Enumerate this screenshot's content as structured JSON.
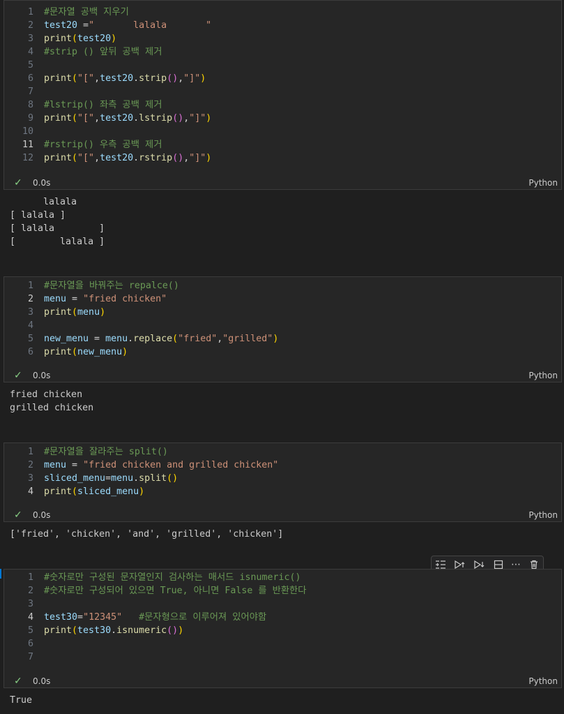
{
  "cells": [
    {
      "lines": [
        [
          {
            "t": "#문자열 공백 지우기",
            "c": "cm"
          }
        ],
        [
          {
            "t": "test20",
            "c": "v"
          },
          {
            "t": " =",
            "c": "p"
          },
          {
            "t": "\"       lalala       \"",
            "c": "s"
          }
        ],
        [
          {
            "t": "print",
            "c": "f"
          },
          {
            "t": "(",
            "c": "b1"
          },
          {
            "t": "test20",
            "c": "v"
          },
          {
            "t": ")",
            "c": "b1"
          }
        ],
        [
          {
            "t": "#strip () 앞뒤 공백 제거",
            "c": "cm"
          }
        ],
        [],
        [
          {
            "t": "print",
            "c": "f"
          },
          {
            "t": "(",
            "c": "b1"
          },
          {
            "t": "\"[\"",
            "c": "s"
          },
          {
            "t": ",",
            "c": "p"
          },
          {
            "t": "test20",
            "c": "v"
          },
          {
            "t": ".",
            "c": "p"
          },
          {
            "t": "strip",
            "c": "f"
          },
          {
            "t": "()",
            "c": "b2"
          },
          {
            "t": ",",
            "c": "p"
          },
          {
            "t": "\"]\"",
            "c": "s"
          },
          {
            "t": ")",
            "c": "b1"
          }
        ],
        [],
        [
          {
            "t": "#lstrip() 좌측 공백 제거",
            "c": "cm"
          }
        ],
        [
          {
            "t": "print",
            "c": "f"
          },
          {
            "t": "(",
            "c": "b1"
          },
          {
            "t": "\"[\"",
            "c": "s"
          },
          {
            "t": ",",
            "c": "p"
          },
          {
            "t": "test20",
            "c": "v"
          },
          {
            "t": ".",
            "c": "p"
          },
          {
            "t": "lstrip",
            "c": "f"
          },
          {
            "t": "()",
            "c": "b2"
          },
          {
            "t": ",",
            "c": "p"
          },
          {
            "t": "\"]\"",
            "c": "s"
          },
          {
            "t": ")",
            "c": "b1"
          }
        ],
        [],
        [
          {
            "t": "#rstrip() 우측 공백 제거",
            "c": "cm"
          }
        ],
        [
          {
            "t": "print",
            "c": "f"
          },
          {
            "t": "(",
            "c": "b1"
          },
          {
            "t": "\"[\"",
            "c": "s"
          },
          {
            "t": ",",
            "c": "p"
          },
          {
            "t": "test20",
            "c": "v"
          },
          {
            "t": ".",
            "c": "p"
          },
          {
            "t": "rstrip",
            "c": "f"
          },
          {
            "t": "()",
            "c": "b2"
          },
          {
            "t": ",",
            "c": "p"
          },
          {
            "t": "\"]\"",
            "c": "s"
          },
          {
            "t": ")",
            "c": "b1"
          }
        ]
      ],
      "active_line": 11,
      "time": "0.0s",
      "lang": "Python",
      "output": [
        "      lalala",
        "[ lalala ]",
        "[ lalala        ]",
        "[        lalala ]"
      ]
    },
    {
      "lines": [
        [
          {
            "t": "#문자열을 바꿔주는 repalce()",
            "c": "cm"
          }
        ],
        [
          {
            "t": "menu",
            "c": "v"
          },
          {
            "t": " = ",
            "c": "p"
          },
          {
            "t": "\"fried chicken\"",
            "c": "s"
          }
        ],
        [
          {
            "t": "print",
            "c": "f"
          },
          {
            "t": "(",
            "c": "b1"
          },
          {
            "t": "menu",
            "c": "v"
          },
          {
            "t": ")",
            "c": "b1"
          }
        ],
        [],
        [
          {
            "t": "new_menu",
            "c": "v"
          },
          {
            "t": " = ",
            "c": "p"
          },
          {
            "t": "menu",
            "c": "v"
          },
          {
            "t": ".",
            "c": "p"
          },
          {
            "t": "replace",
            "c": "f"
          },
          {
            "t": "(",
            "c": "b1"
          },
          {
            "t": "\"fried\"",
            "c": "s"
          },
          {
            "t": ",",
            "c": "p"
          },
          {
            "t": "\"grilled\"",
            "c": "s"
          },
          {
            "t": ")",
            "c": "b1"
          }
        ],
        [
          {
            "t": "print",
            "c": "f"
          },
          {
            "t": "(",
            "c": "b1"
          },
          {
            "t": "new_menu",
            "c": "v"
          },
          {
            "t": ")",
            "c": "b1"
          }
        ]
      ],
      "active_line": 2,
      "time": "0.0s",
      "lang": "Python",
      "output": [
        "fried chicken",
        "grilled chicken"
      ]
    },
    {
      "lines": [
        [
          {
            "t": "#문자열을 잘라주는 split()",
            "c": "cm"
          }
        ],
        [
          {
            "t": "menu",
            "c": "v"
          },
          {
            "t": " = ",
            "c": "p"
          },
          {
            "t": "\"fried chicken and grilled chicken\"",
            "c": "s"
          }
        ],
        [
          {
            "t": "sliced_menu",
            "c": "v"
          },
          {
            "t": "=",
            "c": "p"
          },
          {
            "t": "menu",
            "c": "v"
          },
          {
            "t": ".",
            "c": "p"
          },
          {
            "t": "split",
            "c": "f"
          },
          {
            "t": "()",
            "c": "b1"
          }
        ],
        [
          {
            "t": "print",
            "c": "f"
          },
          {
            "t": "(",
            "c": "b1"
          },
          {
            "t": "sliced_menu",
            "c": "v"
          },
          {
            "t": ")",
            "c": "b1"
          }
        ]
      ],
      "active_line": 4,
      "time": "0.0s",
      "lang": "Python",
      "output": [
        "['fried', 'chicken', 'and', 'grilled', 'chicken']"
      ]
    },
    {
      "lines": [
        [
          {
            "t": "#숫자로만 구성된 문자열인지 검사하는 매서드 isnumeric()",
            "c": "cm"
          }
        ],
        [
          {
            "t": "#숫자로만 구성되어 있으면 True, 아니면 False 를 반환한다",
            "c": "cm"
          }
        ],
        [],
        [
          {
            "t": "test30",
            "c": "v"
          },
          {
            "t": "=",
            "c": "p"
          },
          {
            "t": "\"12345\"",
            "c": "s"
          },
          {
            "t": "   ",
            "c": "p"
          },
          {
            "t": "#문자형으로 이루어져 있어야함",
            "c": "cm"
          }
        ],
        [
          {
            "t": "print",
            "c": "f"
          },
          {
            "t": "(",
            "c": "b1"
          },
          {
            "t": "test30",
            "c": "v"
          },
          {
            "t": ".",
            "c": "p"
          },
          {
            "t": "isnumeric",
            "c": "f"
          },
          {
            "t": "()",
            "c": "b2"
          },
          {
            "t": ")",
            "c": "b1"
          }
        ],
        [],
        []
      ],
      "active_line": 4,
      "time": "0.0s",
      "lang": "Python",
      "output": [
        "True"
      ]
    }
  ],
  "toolbar": {
    "icons": [
      "execute-above-icon",
      "run-above-icon",
      "run-below-icon",
      "split-cell-icon",
      "more-icon",
      "delete-icon"
    ],
    "more_label": "⋯"
  }
}
